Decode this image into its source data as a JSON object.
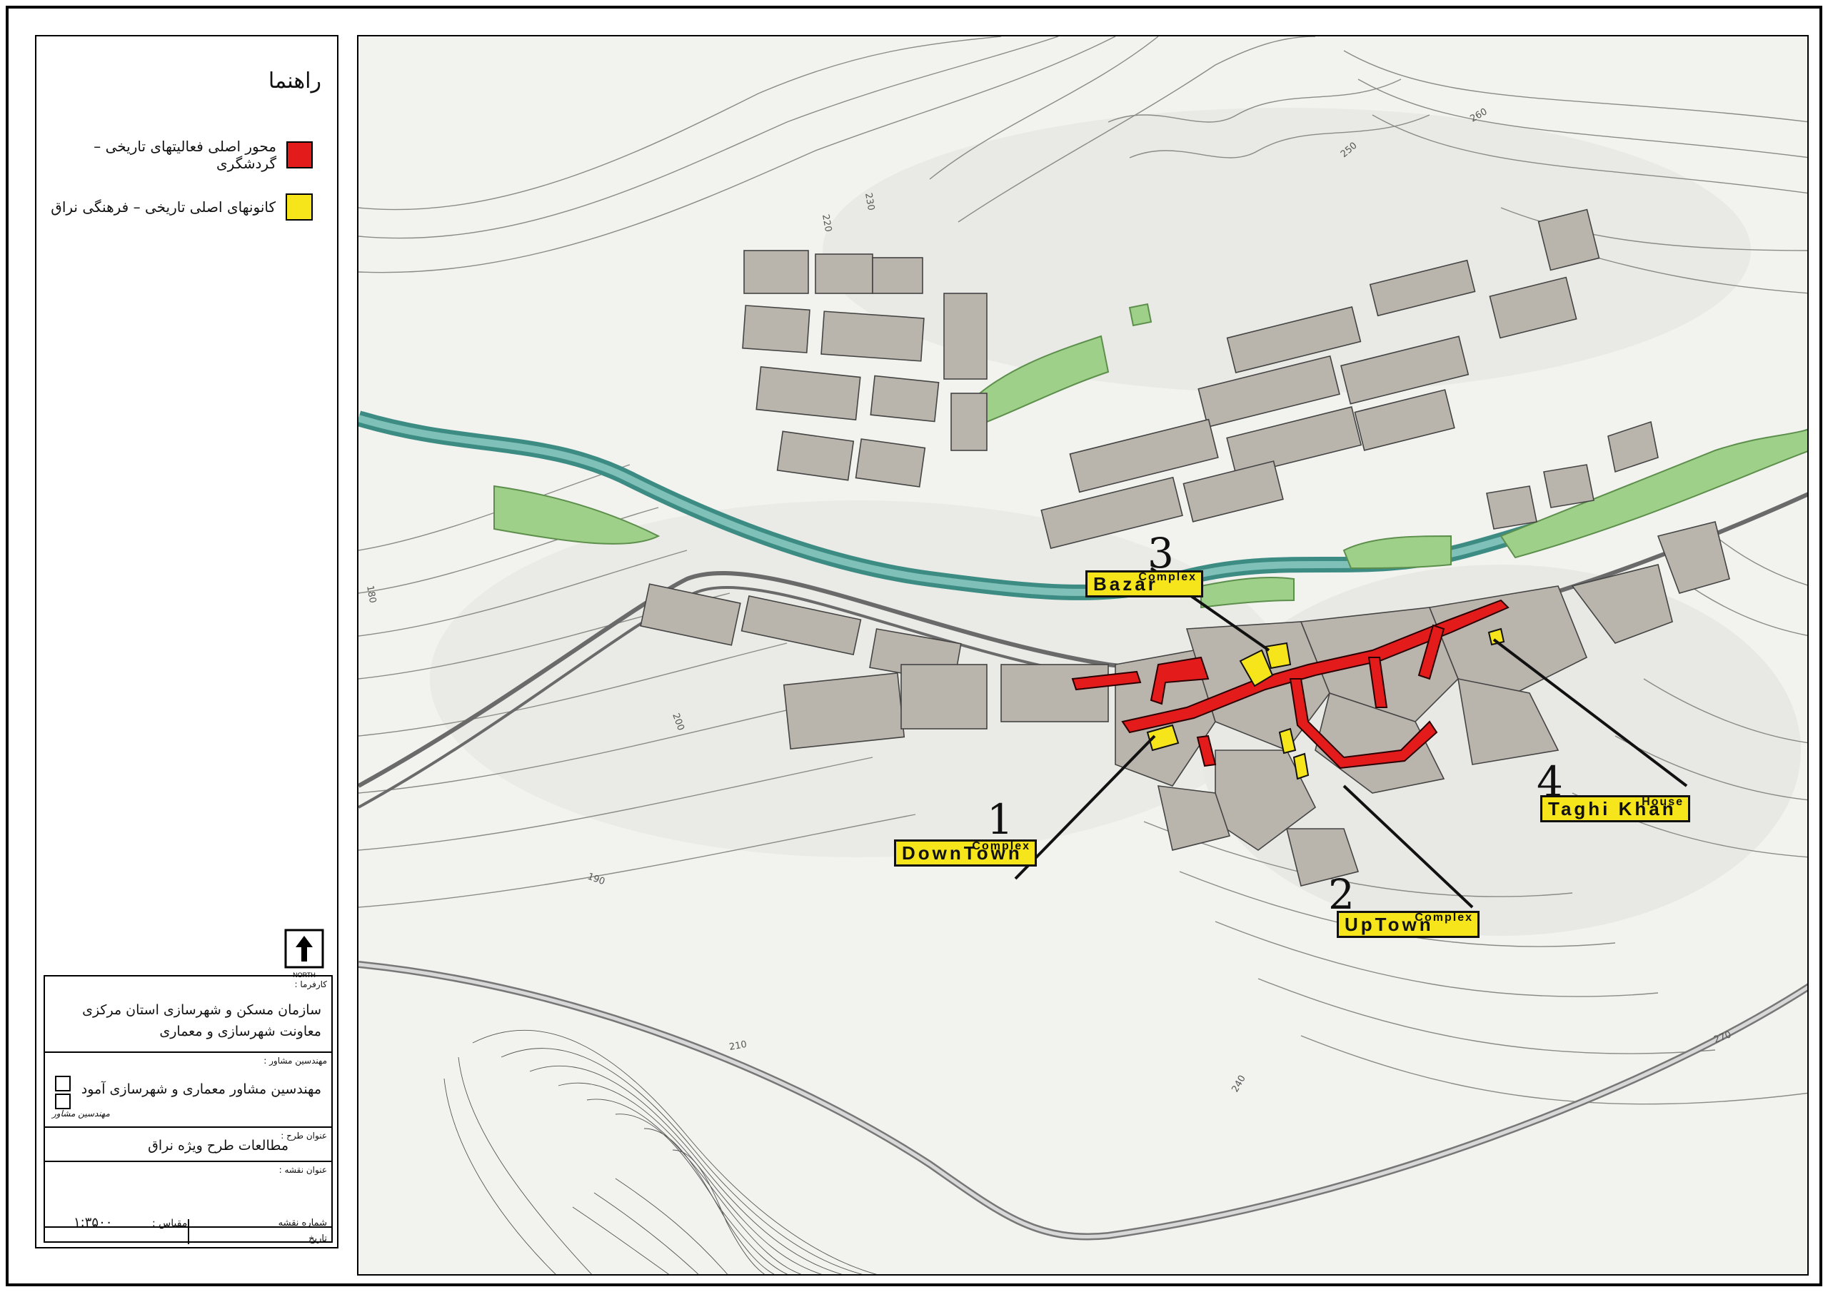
{
  "legend": {
    "title": "راهنما",
    "items": [
      {
        "label": "محور اصلی فعالیتهای تاریخی – گردشگری",
        "color": "#e31b1b"
      },
      {
        "label": "کانونهای اصلی تاریخی – فرهنگی نراق",
        "color": "#f5e51a"
      }
    ]
  },
  "north": {
    "label": "NORTH"
  },
  "title_block": {
    "client_caption": "کارفرما :",
    "client_line1": "سازمان مسکن و شهرسازی استان مرکزی",
    "client_line2": "معاونت شهرسازی و معماری",
    "consultant_caption": "مهندسین مشاور :",
    "consultant_name": "مهندسین مشاور معماری و شهرسازی آمود",
    "consultant_signature": "مهندسین مشاور",
    "project_caption": "عنوان طرح :",
    "project_title": "مطالعات طرح ویژه نراق",
    "map_title_caption": "عنوان نقشه :",
    "map_number_caption": "شماره نقشه",
    "scale_caption": "مقیاس :",
    "scale_value": "۱:۳۵۰۰",
    "date_caption": "تاریخ"
  },
  "map": {
    "colors": {
      "route": "#e31b1b",
      "core": "#f5e51a",
      "green": "#9fd08a",
      "river": "#6aa8a0",
      "block": "#b9b4ac"
    },
    "contour_labels": [
      "180",
      "190",
      "200",
      "210",
      "220",
      "230",
      "240",
      "250",
      "260",
      "270"
    ]
  },
  "callouts": [
    {
      "num": "1",
      "small": "Complex",
      "big": "DownTown"
    },
    {
      "num": "2",
      "small": "Complex",
      "big": "UpTown"
    },
    {
      "num": "3",
      "small": "Complex",
      "big": "Bazar"
    },
    {
      "num": "4",
      "small": "House",
      "big": "Taghi Khan"
    }
  ]
}
